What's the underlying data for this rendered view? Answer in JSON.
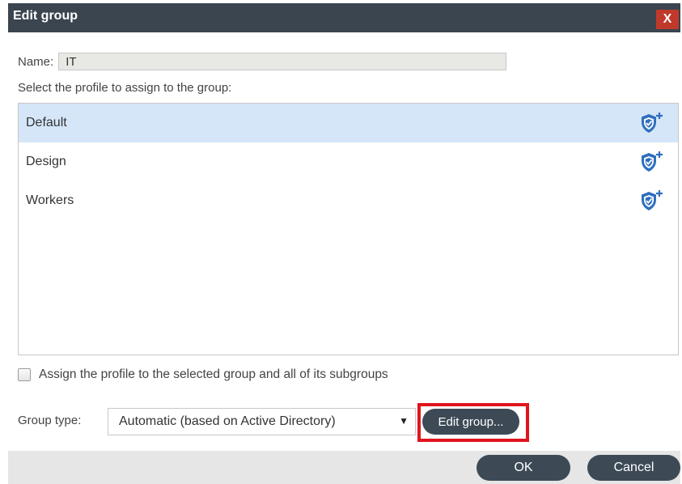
{
  "window": {
    "title": "Edit group",
    "close_label": "X"
  },
  "name": {
    "label": "Name:",
    "value": "IT"
  },
  "profile_select_label": "Select the profile to assign to the group:",
  "profiles": [
    {
      "label": "Default",
      "selected": true,
      "icon": "shield-plus-icon"
    },
    {
      "label": "Design",
      "selected": false,
      "icon": "shield-plus-icon"
    },
    {
      "label": "Workers",
      "selected": false,
      "icon": "shield-plus-icon"
    }
  ],
  "subgroups_checkbox": {
    "label": "Assign the profile to the selected group and all of its subgroups",
    "checked": false
  },
  "group_type": {
    "label": "Group type:",
    "selected": "Automatic (based on Active Directory)"
  },
  "edit_group_button": "Edit group...",
  "footer": {
    "ok": "OK",
    "cancel": "Cancel"
  },
  "colors": {
    "titlebar": "#3a4550",
    "close": "#c0392b",
    "selection": "#d4e6f8",
    "button": "#3d4a56",
    "highlight": "#e0141e",
    "shield": "#2f6fbe"
  }
}
